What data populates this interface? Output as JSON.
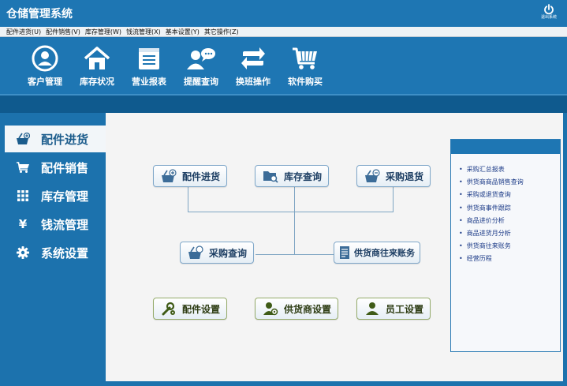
{
  "app": {
    "title": "仓储管理系统",
    "exit_label": "退出系统"
  },
  "menu": [
    "配件进货(U)",
    "配件销售(V)",
    "库存管理(W)",
    "钱流管理(X)",
    "基本设置(Y)",
    "其它操作(Z)"
  ],
  "toolbar": [
    {
      "label": "客户管理",
      "icon": "user-circle-icon"
    },
    {
      "label": "库存状况",
      "icon": "house-icon"
    },
    {
      "label": "营业报表",
      "icon": "list-icon"
    },
    {
      "label": "提醒查询",
      "icon": "chat-user-icon"
    },
    {
      "label": "换班操作",
      "icon": "switch-arrows-icon"
    },
    {
      "label": "软件购买",
      "icon": "cart-icon"
    }
  ],
  "sidebar": [
    {
      "label": "配件进货",
      "icon": "basket-plus-icon",
      "active": true
    },
    {
      "label": "配件销售",
      "icon": "cart-icon",
      "active": false
    },
    {
      "label": "库存管理",
      "icon": "grid-icon",
      "active": false
    },
    {
      "label": "钱流管理",
      "icon": "yen-icon",
      "active": false
    },
    {
      "label": "系统设置",
      "icon": "gear-icon",
      "active": false
    }
  ],
  "flow": {
    "purchase": "配件进货",
    "stock_query": "库存查询",
    "purchase_return": "采购退货",
    "purchase_query": "采购查询",
    "supplier_accounts": "供货商往来账务",
    "parts_settings": "配件设置",
    "supplier_settings": "供货商设置",
    "staff_settings": "员工设置"
  },
  "reports": [
    "采购汇总报表",
    "供货商商品销售查询",
    "采购或退货查询",
    "供货商事件跟踪",
    "商品进价分析",
    "商品进货月分析",
    "供货商往来账务",
    "经营历程"
  ],
  "colors": {
    "primary": "#1e76b3",
    "panel_bg": "#f4f4f4",
    "button_text": "#1d3e63"
  }
}
